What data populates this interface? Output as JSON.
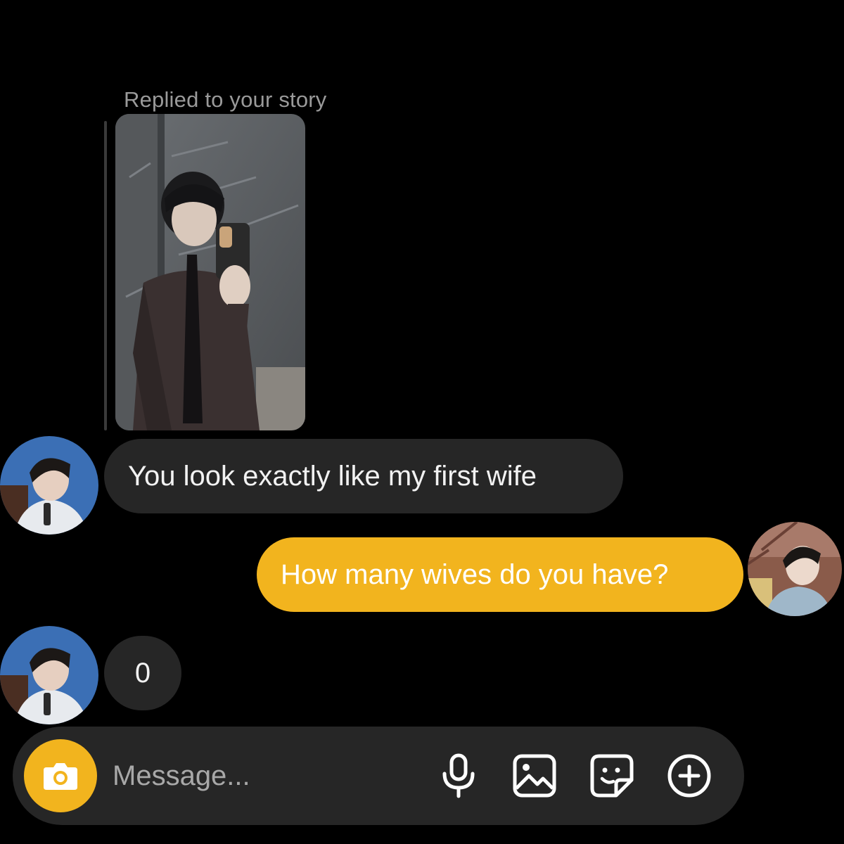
{
  "story_reply": {
    "label": "Replied to your story",
    "thumbnail": "story-photo"
  },
  "messages": [
    {
      "sender": "other",
      "text": "You look exactly like my first wife"
    },
    {
      "sender": "me",
      "text": "How many wives do you have?"
    },
    {
      "sender": "other",
      "text": "0"
    }
  ],
  "composer": {
    "placeholder": "Message...",
    "icons": [
      "camera-icon",
      "microphone-icon",
      "gallery-icon",
      "sticker-icon",
      "add-icon"
    ]
  },
  "colors": {
    "background": "#000000",
    "incoming_bubble": "#262626",
    "outgoing_bubble": "#f2b41e",
    "accent": "#f2b41e"
  }
}
